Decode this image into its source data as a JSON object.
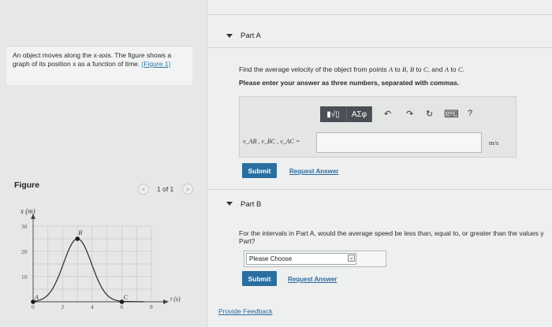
{
  "problem": {
    "text": "An object moves along the x-axis. The figure shows a graph of its position x as a function of time.",
    "figure_link": "(Figure 1)"
  },
  "figure": {
    "label": "Figure",
    "pager": "1 of 1",
    "prev": "<",
    "next": ">"
  },
  "chart_data": {
    "type": "line",
    "xlabel": "t (s)",
    "ylabel": "x (m)",
    "xlim": [
      0,
      8
    ],
    "ylim": [
      0,
      30
    ],
    "xticks": [
      "0",
      "2",
      "4",
      "6",
      "8"
    ],
    "yticks": [
      "10",
      "20",
      "30"
    ],
    "grid": true,
    "points": [
      {
        "label": "A",
        "x": 0,
        "y": 0
      },
      {
        "label": "B",
        "x": 3,
        "y": 25
      },
      {
        "label": "C",
        "x": 6,
        "y": 0
      }
    ]
  },
  "partA": {
    "title": "Part A",
    "prompt_start": "Find the average velocity of the object from points ",
    "prompt_a": "A",
    "prompt_to1": " to ",
    "prompt_b": "B",
    "prompt_comma1": ", ",
    "prompt_b2": "B",
    "prompt_to2": " to ",
    "prompt_c": "C",
    "prompt_and": ", and ",
    "prompt_a2": "A",
    "prompt_to3": " to ",
    "prompt_c2": "C",
    "prompt_end": ".",
    "instruction": "Please enter your answer as three numbers, separated with commas.",
    "toolbar": {
      "templates_label": "▮√▯",
      "symbols_label": "ΑΣφ",
      "undo_icon": "↶",
      "redo_icon": "↷",
      "reset_icon": "↻",
      "keyboard_icon": "⌨",
      "help_label": "?"
    },
    "variables": "v_AB , v_BC , v_AC =",
    "input_value": "",
    "unit": "m/s",
    "submit": "Submit",
    "request": "Request Answer"
  },
  "partB": {
    "title": "Part B",
    "prompt": "For the intervals in Part A, would the average speed be less than, equal to, or greater than the values y",
    "prompt2": "Part?",
    "select_value": "Please Choose",
    "submit": "Submit",
    "request": "Request Answer"
  },
  "feedback": "Provide Feedback"
}
